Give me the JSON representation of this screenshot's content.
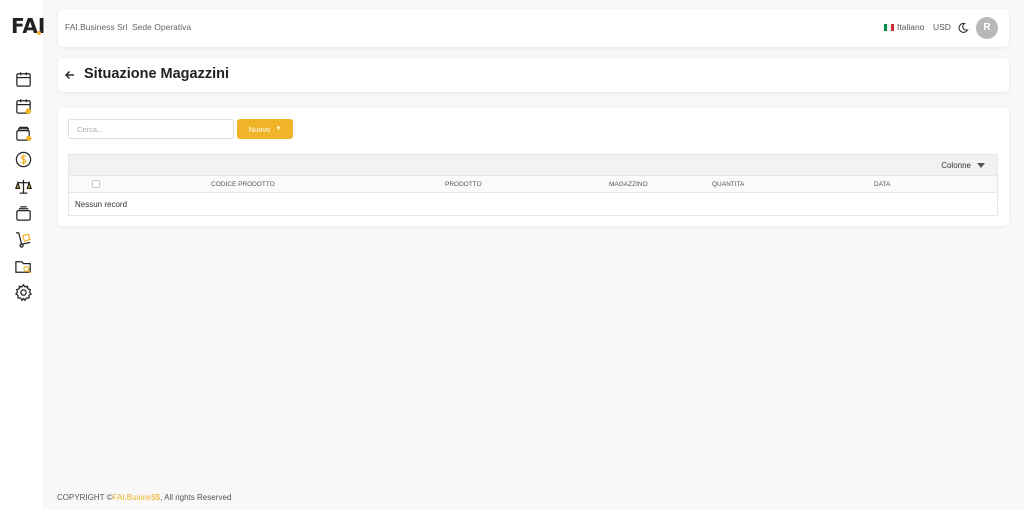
{
  "sidebar": {
    "logo": "FAI",
    "items": [
      {
        "icon": "calendar-icon"
      },
      {
        "icon": "calendar-user-icon"
      },
      {
        "icon": "wallet-icon"
      },
      {
        "icon": "dollar-coin-icon"
      },
      {
        "icon": "balance-scale-icon"
      },
      {
        "icon": "stack-icon"
      },
      {
        "icon": "hand-truck-icon"
      },
      {
        "icon": "folder-search-icon"
      },
      {
        "icon": "settings-gear-icon"
      }
    ]
  },
  "topbar": {
    "company": "FAI.Business Srl",
    "location": "Sede Operativa",
    "language": "Italiano",
    "currency": "USD",
    "avatar_initial": "R"
  },
  "page": {
    "title": "Situazione Magazzini"
  },
  "toolbar": {
    "search_placeholder": "Cerca...",
    "new_label": "Nuovo"
  },
  "table": {
    "columns_button": "Colonne",
    "headers": [
      "CODICE PRODOTTO",
      "PRODOTTO",
      "MAGAZZINO",
      "QUANTITA",
      "DATA"
    ],
    "empty_message": "Nessun record"
  },
  "footer": {
    "prefix": "COPYRIGHT ©",
    "brand": "FAI.Busine$$",
    "suffix": ", All rights Reserved"
  },
  "colors": {
    "accent": "#f0b429",
    "background": "#f8f8f8"
  }
}
